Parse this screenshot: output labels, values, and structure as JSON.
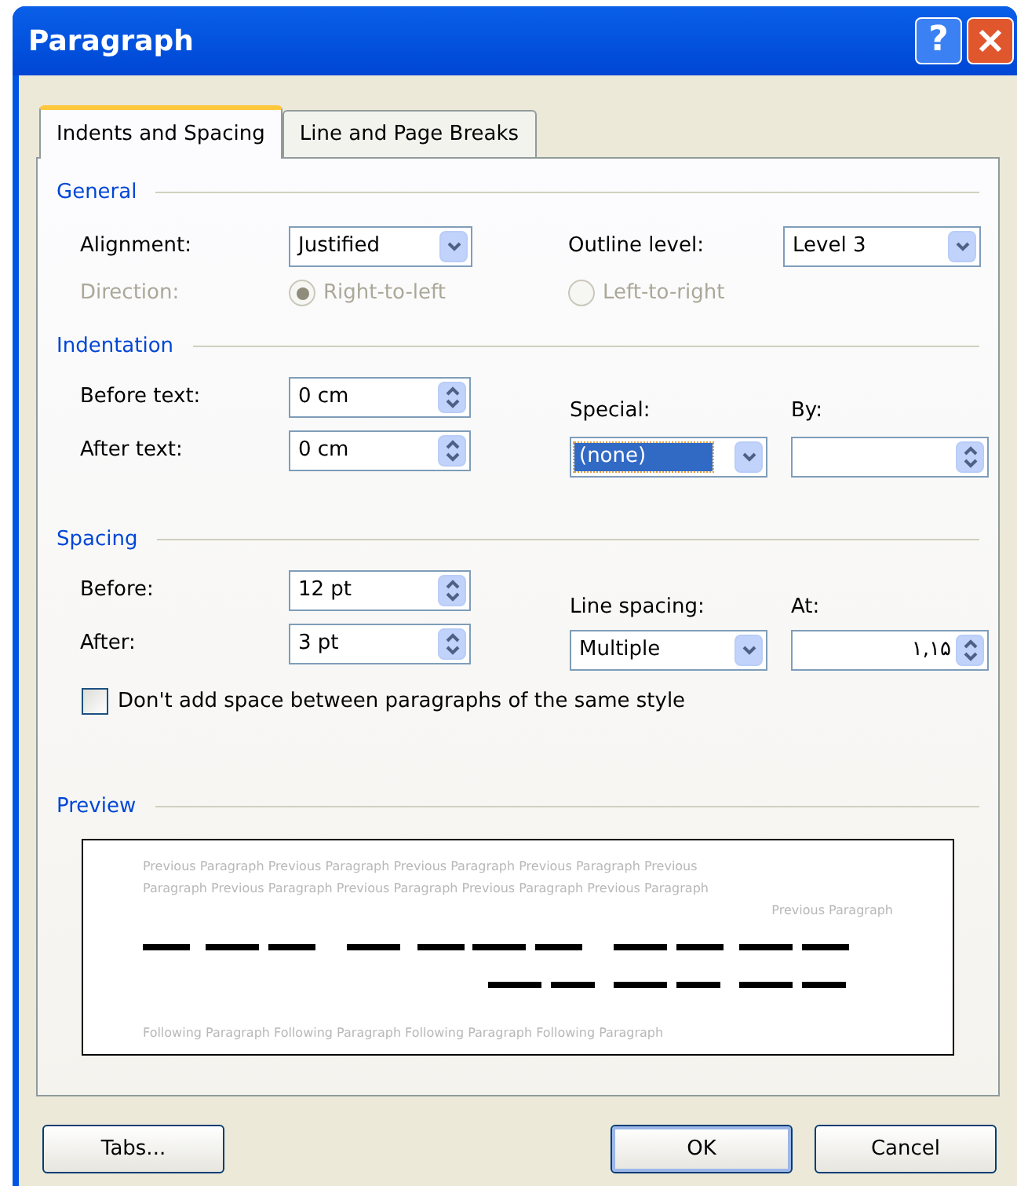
{
  "window": {
    "title": "Paragraph"
  },
  "title_buttons": [
    {
      "kind": "help",
      "label": "?"
    },
    {
      "kind": "close"
    }
  ],
  "tabs": [
    {
      "label": "Indents and Spacing",
      "selected": true
    },
    {
      "label": "Line and Page Breaks",
      "selected": false
    }
  ],
  "general": {
    "heading": "General",
    "alignment": {
      "label": "Alignment:",
      "value": "Justified"
    },
    "outline_level": {
      "label": "Outline level:",
      "value": "Level 3"
    },
    "direction": {
      "label": "Direction:",
      "disabled": true,
      "options": [
        {
          "label": "Right-to-left",
          "selected": true
        },
        {
          "label": "Left-to-right",
          "selected": false
        }
      ]
    }
  },
  "indentation": {
    "heading": "Indentation",
    "before_text": {
      "label": "Before text:",
      "value": "0 cm"
    },
    "after_text": {
      "label": "After text:",
      "value": "0 cm"
    },
    "special": {
      "label": "Special:",
      "value": "(none)",
      "focused": true
    },
    "by": {
      "label": "By:"
    }
  },
  "spacing": {
    "heading": "Spacing",
    "before": {
      "label": "Before:",
      "value": "12 pt"
    },
    "after": {
      "label": "After:",
      "value": "3 pt"
    },
    "line_spacing": {
      "label": "Line spacing:",
      "value": "Multiple"
    },
    "at": {
      "label": "At:",
      "value": "۱,۱۵"
    },
    "no_space_same_style": {
      "label": "Don't add space between paragraphs of the same style",
      "checked": false
    }
  },
  "preview": {
    "heading": "Preview",
    "previous_lines": [
      "Previous Paragraph Previous Paragraph Previous Paragraph Previous Paragraph Previous",
      "Paragraph Previous Paragraph Previous Paragraph Previous Paragraph Previous Paragraph",
      "Previous Paragraph"
    ],
    "following_lines": [
      "Following Paragraph Following Paragraph Following Paragraph Following Paragraph"
    ]
  },
  "buttons": [
    {
      "label": "Tabs...",
      "default": false
    },
    {
      "label": "OK",
      "default": true
    },
    {
      "label": "Cancel",
      "default": false
    }
  ]
}
